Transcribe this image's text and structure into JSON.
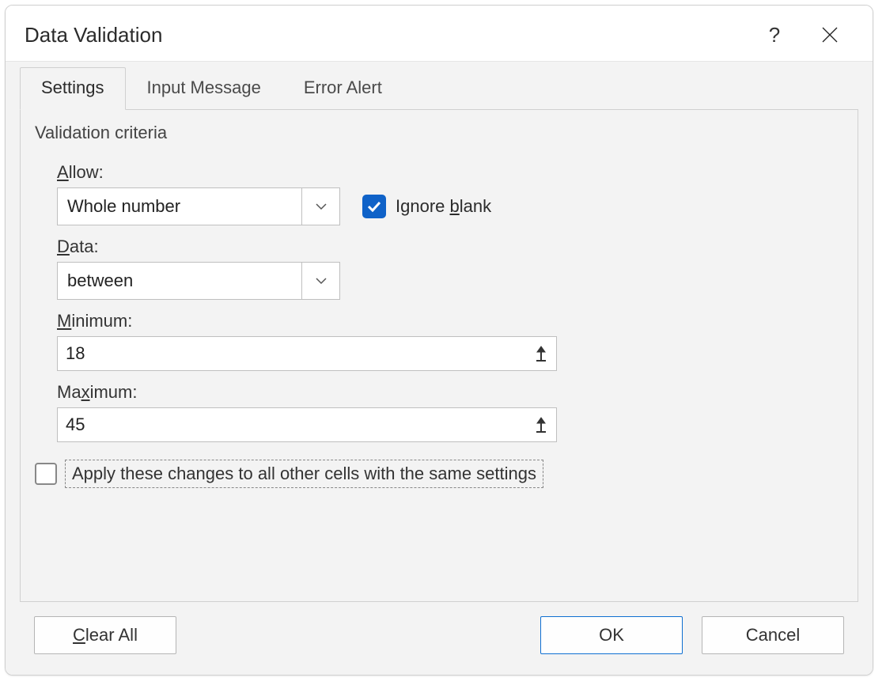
{
  "title": "Data Validation",
  "icons": {
    "help": "help-icon",
    "close": "close-icon"
  },
  "tabs": [
    {
      "label": "Settings",
      "active": true
    },
    {
      "label": "Input Message",
      "active": false
    },
    {
      "label": "Error Alert",
      "active": false
    }
  ],
  "section_label": "Validation criteria",
  "fields": {
    "allow": {
      "label": "Allow:",
      "value": "Whole number",
      "mnemonic": "A"
    },
    "ignore_blank": {
      "label": "Ignore blank",
      "checked": true,
      "mnemonic": "b"
    },
    "data": {
      "label": "Data:",
      "value": "between",
      "mnemonic": "D"
    },
    "minimum": {
      "label": "Minimum:",
      "value": "18",
      "mnemonic": "M"
    },
    "maximum": {
      "label": "Maximum:",
      "value": "45",
      "mnemonic": "x"
    }
  },
  "apply_all": {
    "label": "Apply these changes to all other cells with the same settings",
    "checked": false
  },
  "buttons": {
    "clear_all": "Clear All",
    "ok": "OK",
    "cancel": "Cancel"
  }
}
